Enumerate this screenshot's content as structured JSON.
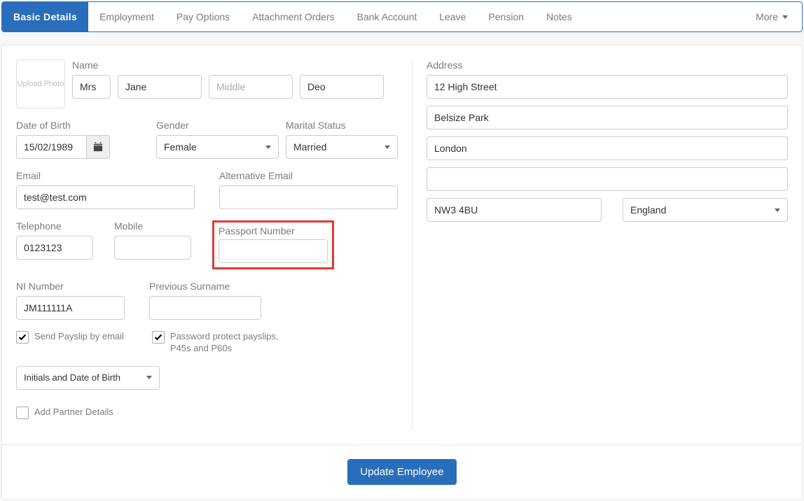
{
  "tabs": {
    "items": [
      "Basic Details",
      "Employment",
      "Pay Options",
      "Attachment Orders",
      "Bank Account",
      "Leave",
      "Pension",
      "Notes"
    ],
    "more": "More"
  },
  "upload_label": "Upload Photo",
  "name": {
    "label": "Name",
    "title": "Mrs",
    "first": "Jane",
    "middle_placeholder": "Middle",
    "last": "Deo"
  },
  "dob": {
    "label": "Date of Birth",
    "value": "15/02/1989"
  },
  "gender": {
    "label": "Gender",
    "value": "Female"
  },
  "marital": {
    "label": "Marital Status",
    "value": "Married"
  },
  "email": {
    "label": "Email",
    "value": "test@test.com"
  },
  "alt_email": {
    "label": "Alternative Email",
    "value": ""
  },
  "telephone": {
    "label": "Telephone",
    "value": "0123123"
  },
  "mobile": {
    "label": "Mobile",
    "value": ""
  },
  "passport": {
    "label": "Passport Number",
    "value": ""
  },
  "ni": {
    "label": "NI Number",
    "value": "JM111111A"
  },
  "prev_surname": {
    "label": "Previous Surname",
    "value": ""
  },
  "send_payslip": {
    "label": "Send Payslip by email",
    "checked": true
  },
  "pw_protect": {
    "label": "Password protect payslips, P45s and P60s",
    "checked": true
  },
  "pw_mode": "Initials and Date of Birth",
  "add_partner": {
    "label": "Add Partner Details",
    "checked": false
  },
  "address": {
    "label": "Address",
    "line1": "12 High Street",
    "line2": "Belsize Park",
    "line3": "London",
    "line4": "",
    "postcode": "NW3 4BU",
    "country": "England"
  },
  "submit_label": "Update Employee"
}
